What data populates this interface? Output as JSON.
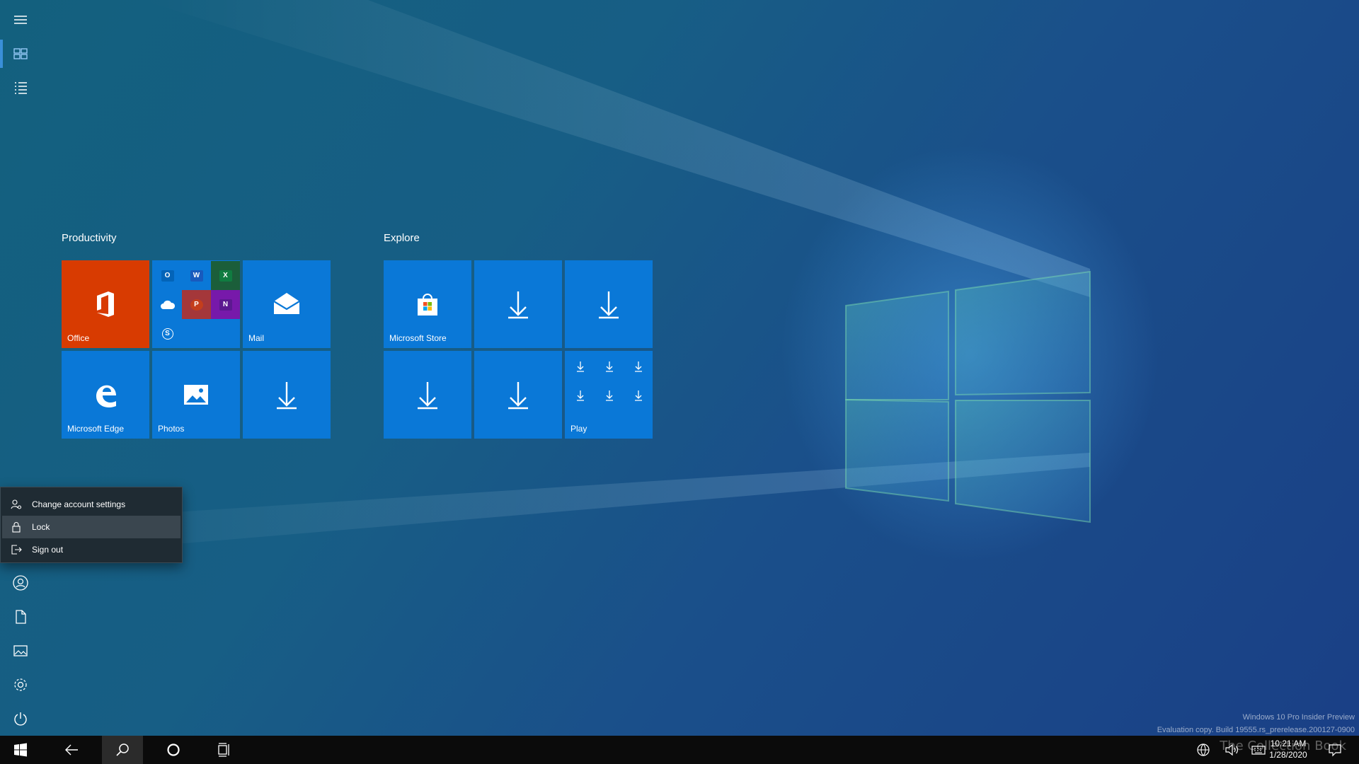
{
  "groups": [
    {
      "title": "Productivity",
      "tiles": [
        {
          "label": "Office",
          "icon": "office-icon",
          "color": "#d83b01"
        },
        {
          "label": "",
          "icon": "office-apps-folder"
        },
        {
          "label": "Mail",
          "icon": "mail-icon"
        },
        {
          "label": "Microsoft Edge",
          "icon": "edge-icon"
        },
        {
          "label": "Photos",
          "icon": "photos-icon"
        },
        {
          "label": "",
          "icon": "download-icon"
        }
      ]
    },
    {
      "title": "Explore",
      "tiles": [
        {
          "label": "Microsoft Store",
          "icon": "store-icon"
        },
        {
          "label": "",
          "icon": "download-icon"
        },
        {
          "label": "",
          "icon": "download-icon"
        },
        {
          "label": "",
          "icon": "download-icon"
        },
        {
          "label": "",
          "icon": "download-icon"
        },
        {
          "label": "Play",
          "icon": "play-folder-icon"
        }
      ]
    }
  ],
  "folder_apps": [
    {
      "letter": "O",
      "color": "#0364b8",
      "icon": "outlook-icon"
    },
    {
      "letter": "W",
      "color": "#185abd",
      "icon": "word-icon"
    },
    {
      "letter": "X",
      "color": "#107c41",
      "icon": "excel-icon"
    },
    {
      "letter": "",
      "color": "#ffffff",
      "icon": "onedrive-icon"
    },
    {
      "letter": "P",
      "color": "#c43e1c",
      "icon": "powerpoint-icon"
    },
    {
      "letter": "N",
      "color": "#7719aa",
      "icon": "onenote-icon"
    },
    {
      "letter": "S",
      "color": "#00a2ed",
      "icon": "skype-icon"
    }
  ],
  "account_menu": {
    "items": [
      {
        "label": "Change account settings",
        "icon": "account-settings-icon"
      },
      {
        "label": "Lock",
        "icon": "lock-icon",
        "hover": true
      },
      {
        "label": "Sign out",
        "icon": "sign-out-icon"
      }
    ]
  },
  "rail": {
    "top": [
      "hamburger-icon",
      "pinned-tiles-icon",
      "all-apps-list-icon"
    ],
    "bottom": [
      "user-avatar-icon",
      "documents-icon",
      "pictures-icon",
      "settings-icon",
      "power-icon"
    ]
  },
  "taskbar": {
    "buttons": [
      "windows-start-icon",
      "back-arrow-icon",
      "search-icon",
      "cortana-icon",
      "task-view-icon"
    ],
    "clock_time": "10:21 AM",
    "clock_date": "1/28/2020"
  },
  "watermark": {
    "line1": "Windows 10 Pro Insider Preview",
    "line2": "Evaluation copy. Build 19555.rs_prerelease.200127-0900"
  },
  "brand": "The Collection Book",
  "colors": {
    "accent": "#0a78d7",
    "office": "#d83b01",
    "menu_bg": "#1f2b33"
  }
}
